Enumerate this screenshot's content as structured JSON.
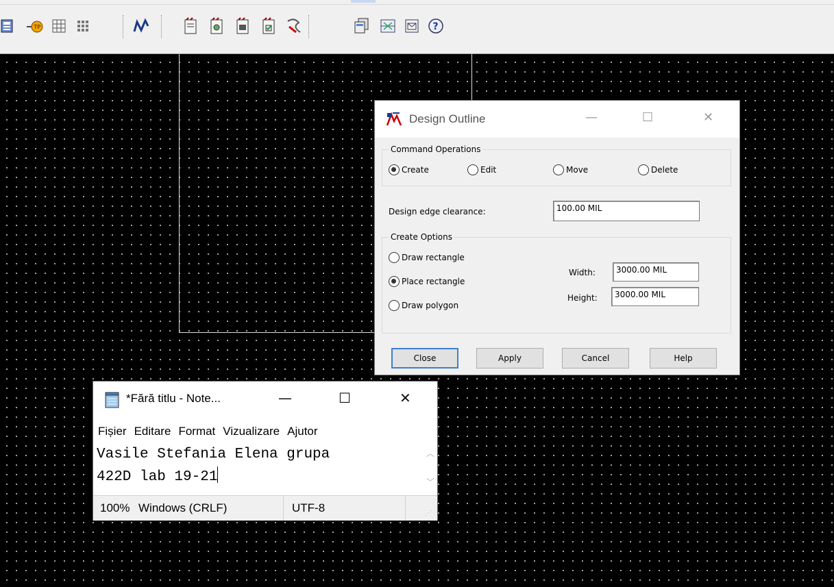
{
  "toolbar": {
    "icons": [
      "report-icon",
      "tp-icon",
      "grid-icon",
      "grid-small-icon",
      "route-icon",
      "doc-icon-1",
      "doc-icon-2",
      "doc-icon-3",
      "doc-icon-4",
      "doc-icon-5",
      "copy-icon",
      "split-icon",
      "window-icon",
      "help-icon"
    ]
  },
  "dialog": {
    "title": "Design Outline",
    "command_group": "Command Operations",
    "commands": [
      "Create",
      "Edit",
      "Move",
      "Delete"
    ],
    "selected_command": "Create",
    "clearance_label": "Design edge clearance:",
    "clearance_value": "100.00 MIL",
    "options_group": "Create Options",
    "options": [
      "Draw rectangle",
      "Place rectangle",
      "Draw polygon"
    ],
    "selected_option": "Place rectangle",
    "width_label": "Width:",
    "width_value": "3000.00 MIL",
    "height_label": "Height:",
    "height_value": "3000.00 MIL",
    "buttons": {
      "close": "Close",
      "apply": "Apply",
      "cancel": "Cancel",
      "help": "Help"
    }
  },
  "notepad": {
    "title": "*Fără titlu - Note...",
    "menu": [
      "Fișier",
      "Editare",
      "Format",
      "Vizualizare",
      "Ajutor"
    ],
    "line1": "Vasile Stefania Elena grupa",
    "line2": "422D lab 19-21",
    "zoom": "100%",
    "line_ending": "Windows (CRLF)",
    "encoding": "UTF-8"
  }
}
